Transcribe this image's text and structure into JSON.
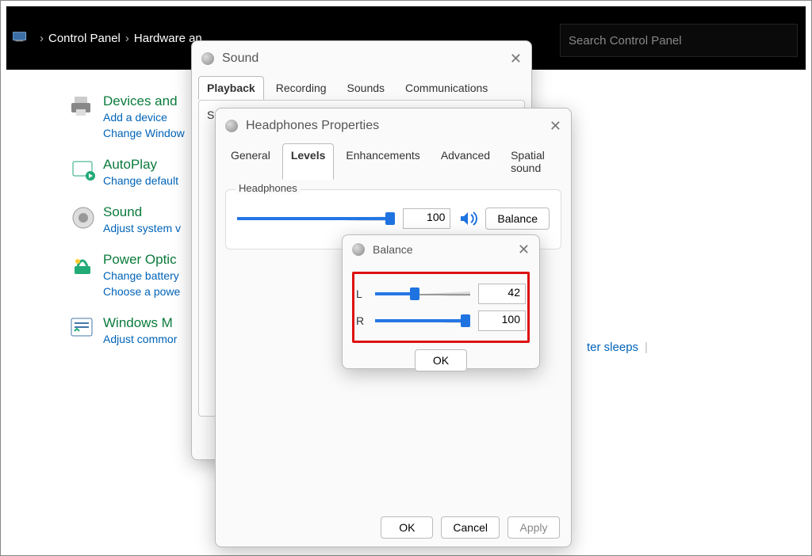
{
  "topbar": {
    "crumbs": [
      "Control Panel",
      "Hardware an"
    ],
    "search_placeholder": "Search Control Panel"
  },
  "categories": [
    {
      "title": "Devices and",
      "links": [
        "Add a device",
        "Change Window"
      ]
    },
    {
      "title": "AutoPlay",
      "links": [
        "Change default"
      ]
    },
    {
      "title": "Sound",
      "links": [
        "Adjust system v"
      ]
    },
    {
      "title": "Power Optic",
      "links": [
        "Change battery",
        "Choose a powe"
      ]
    },
    {
      "title": "Windows M",
      "links": [
        "Adjust commor"
      ]
    }
  ],
  "sound_dialog": {
    "title": "Sound",
    "tabs": [
      "Playback",
      "Recording",
      "Sounds",
      "Communications"
    ],
    "active_tab": 0,
    "hint_prefix": "Sel"
  },
  "props_dialog": {
    "title": "Headphones Properties",
    "tabs": [
      "General",
      "Levels",
      "Enhancements",
      "Advanced",
      "Spatial sound"
    ],
    "active_tab": 1,
    "group_title": "Headphones",
    "volume_value": "100",
    "balance_button": "Balance",
    "buttons": {
      "ok": "OK",
      "cancel": "Cancel",
      "apply": "Apply"
    }
  },
  "balance_dialog": {
    "title": "Balance",
    "left_label": "L",
    "right_label": "R",
    "left_value": "42",
    "right_value": "100",
    "ok": "OK"
  },
  "clipped_link": "ter sleeps"
}
